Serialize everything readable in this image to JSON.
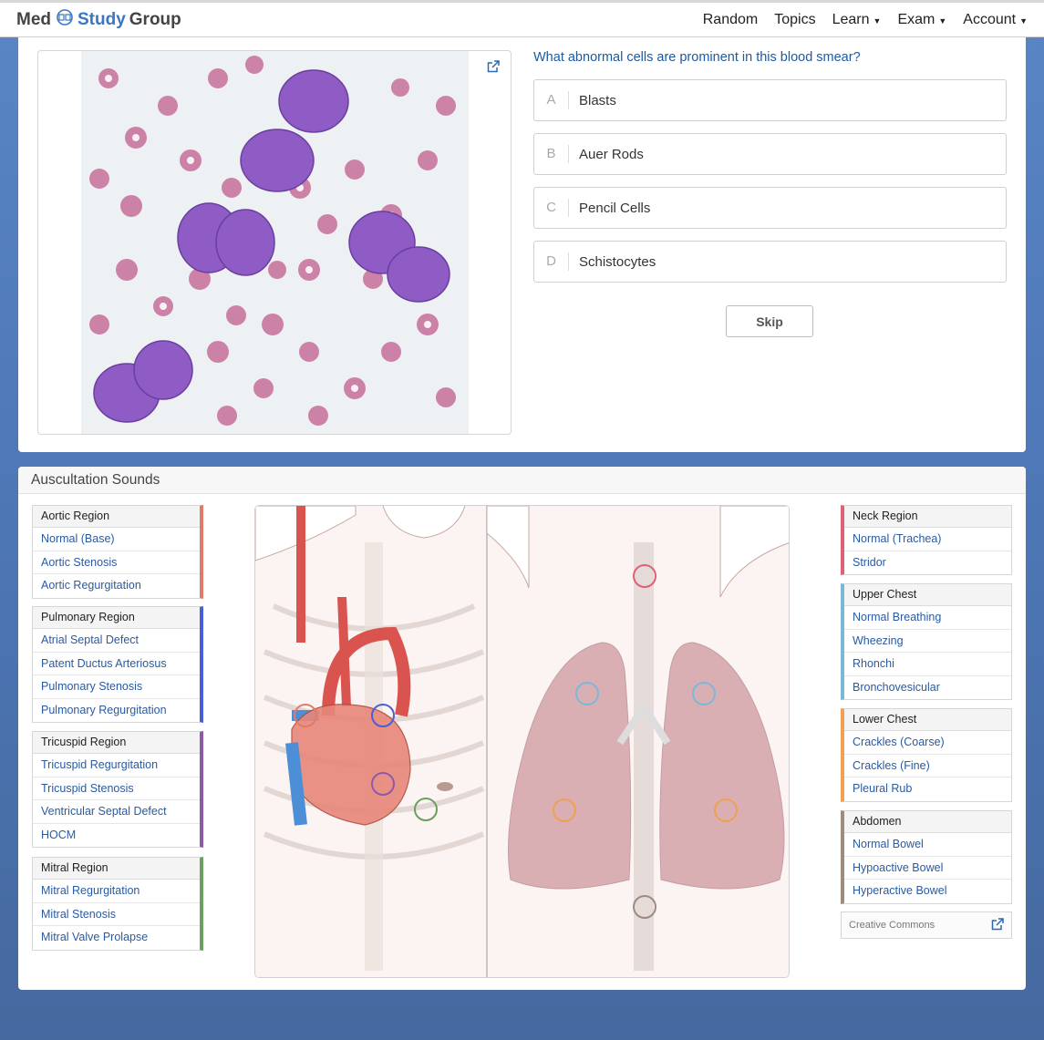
{
  "brand": {
    "part1": "Med",
    "part2": "Study",
    "part3": "Group"
  },
  "nav": {
    "random": "Random",
    "topics": "Topics",
    "learn": "Learn",
    "exam": "Exam",
    "account": "Account"
  },
  "question": {
    "prompt": "What abnormal cells are prominent in this blood smear?",
    "answers": [
      {
        "letter": "A",
        "text": "Blasts"
      },
      {
        "letter": "B",
        "text": "Auer Rods"
      },
      {
        "letter": "C",
        "text": "Pencil Cells"
      },
      {
        "letter": "D",
        "text": "Schistocytes"
      }
    ],
    "skip_label": "Skip"
  },
  "auscultation": {
    "title": "Auscultation Sounds",
    "left_groups": [
      {
        "title": "Aortic Region",
        "color": "#e07a6a",
        "items": [
          "Normal (Base)",
          "Aortic Stenosis",
          "Aortic Regurgitation"
        ]
      },
      {
        "title": "Pulmonary Region",
        "color": "#4a5fd6",
        "items": [
          "Atrial Septal Defect",
          "Patent Ductus Arteriosus",
          "Pulmonary Stenosis",
          "Pulmonary Regurgitation"
        ]
      },
      {
        "title": "Tricuspid Region",
        "color": "#8c5aa6",
        "items": [
          "Tricuspid Regurgitation",
          "Tricuspid Stenosis",
          "Ventricular Septal Defect",
          "HOCM"
        ]
      },
      {
        "title": "Mitral Region",
        "color": "#6aa060",
        "items": [
          "Mitral Regurgitation",
          "Mitral Stenosis",
          "Mitral Valve Prolapse"
        ]
      }
    ],
    "right_groups": [
      {
        "title": "Neck Region",
        "color": "#e0607a",
        "items": [
          "Normal (Trachea)",
          "Stridor"
        ]
      },
      {
        "title": "Upper Chest",
        "color": "#7ab8d8",
        "items": [
          "Normal Breathing",
          "Wheezing",
          "Rhonchi",
          "Bronchovesicular"
        ]
      },
      {
        "title": "Lower Chest",
        "color": "#f0a050",
        "items": [
          "Crackles (Coarse)",
          "Crackles (Fine)",
          "Pleural Rub"
        ]
      },
      {
        "title": "Abdomen",
        "color": "#a08a80",
        "items": [
          "Normal Bowel",
          "Hypoactive Bowel",
          "Hyperactive Bowel"
        ]
      }
    ],
    "license_label": "Creative Commons"
  }
}
